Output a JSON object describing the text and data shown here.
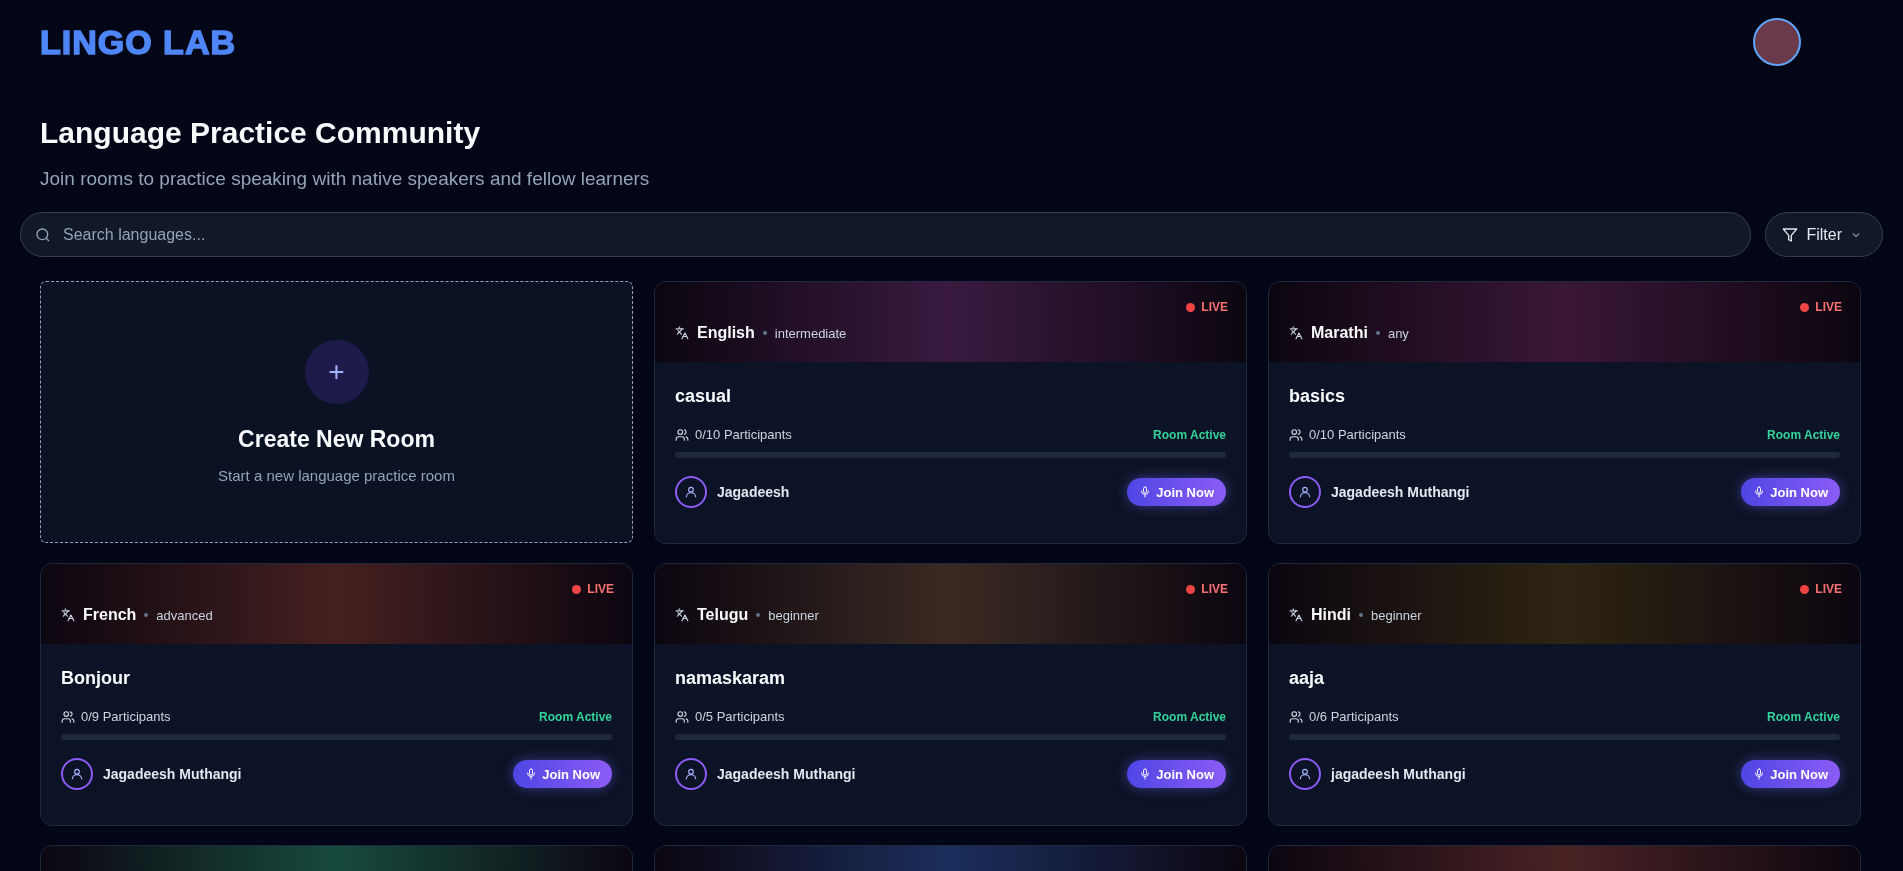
{
  "brand": {
    "logo": "LINGO LAB"
  },
  "hero": {
    "title": "Language Practice Community",
    "subtitle": "Join rooms to practice speaking with native speakers and fellow learners"
  },
  "search": {
    "placeholder": "Search languages..."
  },
  "filter": {
    "label": "Filter"
  },
  "create_card": {
    "icon": "+",
    "title": "Create New Room",
    "subtitle": "Start a new language practice room"
  },
  "rooms": [
    {
      "color": "#3a1a40",
      "live": "LIVE",
      "language": "English",
      "level_name": "intermediate",
      "title": "casual",
      "participants": "0/10 Participants",
      "status": "Room Active",
      "level": 0,
      "host": "Jagadeesh",
      "join": "Join Now"
    },
    {
      "color": "#3a1735",
      "live": "LIVE",
      "language": "Marathi",
      "level_name": "any",
      "title": "basics",
      "participants": "0/10 Participants",
      "status": "Room Active",
      "level": 0,
      "host": "Jagadeesh Muthangi",
      "join": "Join Now"
    },
    {
      "color": "#45201f",
      "live": "LIVE",
      "language": "French",
      "level_name": "advanced",
      "title": "Bonjour",
      "participants": "0/9 Participants",
      "status": "Room Active",
      "level": 0,
      "host": "Jagadeesh Muthangi",
      "join": "Join Now"
    },
    {
      "color": "#3a2a22",
      "live": "LIVE",
      "language": "Telugu",
      "level_name": "beginner",
      "title": "namaskaram",
      "participants": "0/5 Participants",
      "status": "Room Active",
      "level": 0,
      "host": "Jagadeesh Muthangi",
      "join": "Join Now"
    },
    {
      "color": "#2e2412",
      "live": "LIVE",
      "language": "Hindi",
      "level_name": "beginner",
      "title": "aaja",
      "participants": "0/6 Participants",
      "status": "Room Active",
      "level": 0,
      "host": "jagadeesh Muthangi",
      "join": "Join Now"
    },
    {
      "color": "#174a3c"
    },
    {
      "color": "#1b2e5c"
    },
    {
      "color": "#4a2224"
    }
  ]
}
